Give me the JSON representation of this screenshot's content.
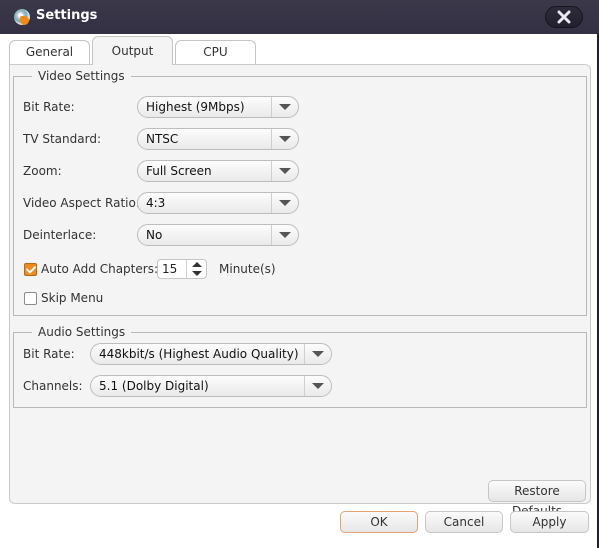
{
  "window": {
    "title": "Settings",
    "app_icon": "dvd-flame-icon",
    "close_icon": "close-x-icon"
  },
  "tabs": [
    {
      "label": "General",
      "active": false
    },
    {
      "label": "Output",
      "active": true
    },
    {
      "label": "CPU",
      "active": false
    }
  ],
  "video": {
    "legend": "Video Settings",
    "bit_rate": {
      "label": "Bit Rate:",
      "value": "Highest (9Mbps)"
    },
    "tv_standard": {
      "label": "TV Standard:",
      "value": "NTSC"
    },
    "zoom": {
      "label": "Zoom:",
      "value": "Full Screen"
    },
    "aspect_ratio": {
      "label": "Video Aspect Ratio:",
      "value": "4:3"
    },
    "deinterlace": {
      "label": "Deinterlace:",
      "value": "No"
    },
    "auto_chapters": {
      "label": "Auto Add Chapters:",
      "checked": true,
      "value": "15",
      "unit": "Minute(s)"
    },
    "skip_menu": {
      "label": "Skip Menu",
      "checked": false
    }
  },
  "audio": {
    "legend": "Audio Settings",
    "bit_rate": {
      "label": "Bit Rate:",
      "value": "448kbit/s (Highest Audio Quality)"
    },
    "channels": {
      "label": "Channels:",
      "value": "5.1 (Dolby Digital)"
    }
  },
  "buttons": {
    "restore_defaults": "Restore Defaults",
    "ok": "OK",
    "cancel": "Cancel",
    "apply": "Apply"
  }
}
